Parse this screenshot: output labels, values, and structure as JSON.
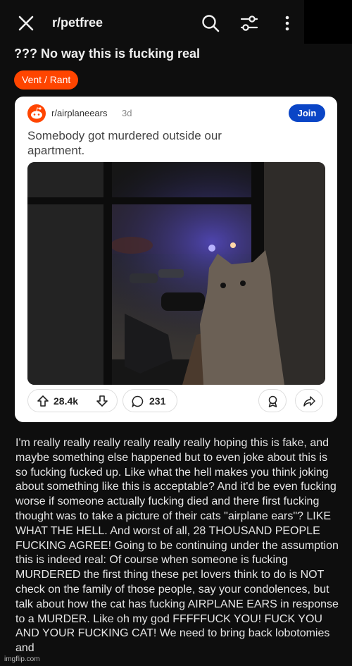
{
  "header": {
    "subreddit": "r/petfree",
    "icons": [
      "close-icon",
      "search-icon",
      "filter-icon",
      "more-vertical-icon"
    ]
  },
  "post": {
    "title": "??? No way this is fucking real",
    "flair": "Vent / Rant",
    "flair_color": "#ff4500"
  },
  "embedded_post": {
    "subreddit": "r/airplaneears",
    "age": "3d",
    "join_label": "Join",
    "title": "Somebody got murdered outside our apartment.",
    "upvotes": "28.4k",
    "comments": "231",
    "icons": [
      "upvote-icon",
      "downvote-icon",
      "comment-icon",
      "award-icon",
      "share-icon"
    ],
    "accent_color": "#0a45c6"
  },
  "body": {
    "text": "I'm really really really really really really hoping this is fake, and maybe something else happened but to even joke about this is so fucking fucked up. Like what the hell makes you think joking about something like this is acceptable? And it'd be even fucking worse if someone actually fucking died and there first fucking thought was to take a picture of their cats \"airplane ears\"? LIKE WHAT THE HELL. And worst of all, 28 THOUSAND PEOPLE FUCKING AGREE! Going to be continuing under the assumption this is indeed real: Of course when someone is fucking MURDERED the first thing these pet lovers think to do is NOT check on the family of those people, say your condolences, but talk about how the cat has fucking AIRPLANE EARS in response to a MURDER. Like oh my god FFFFFUCK YOU! FUCK YOU AND YOUR FUCKING CAT! We need to bring back lobotomies and"
  },
  "watermark": "imgflip.com"
}
